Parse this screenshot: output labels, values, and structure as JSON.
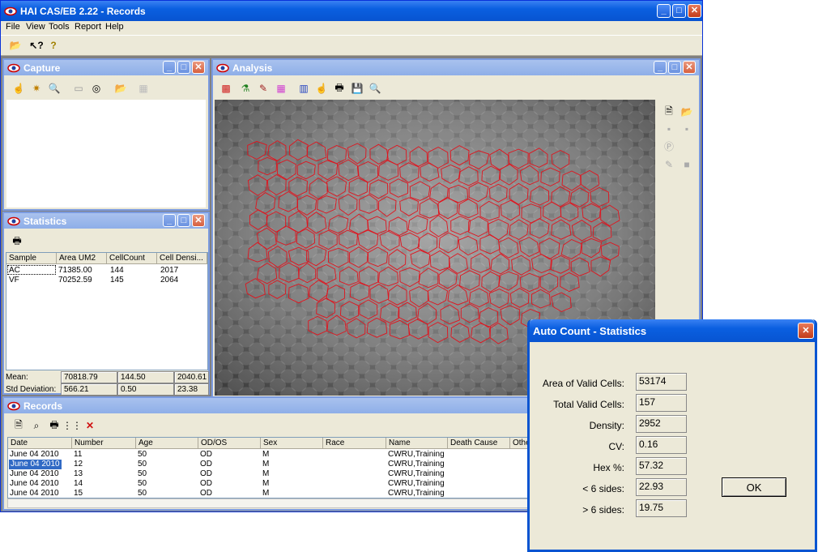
{
  "app": {
    "title": "HAI CAS/EB 2.22 - Records"
  },
  "menu": [
    "File",
    "View",
    "Tools",
    "Report",
    "Help"
  ],
  "capture": {
    "title": "Capture"
  },
  "analysis": {
    "title": "Analysis"
  },
  "statistics": {
    "title": "Statistics",
    "headers": [
      "Sample",
      "Area UM2",
      "CellCount",
      "Cell Densi..."
    ],
    "rows": [
      [
        "AC",
        "71385.00",
        "144",
        "2017"
      ],
      [
        "VF",
        "70252.59",
        "145",
        "2064"
      ]
    ],
    "mean_label": "Mean:",
    "mean": [
      "70818.79",
      "144.50",
      "2040.61"
    ],
    "std_label": "Std Deviation:",
    "std": [
      "566.21",
      "0.50",
      "23.38"
    ]
  },
  "records": {
    "title": "Records",
    "headers": [
      "Date",
      "Number",
      "Age",
      "OD/OS",
      "Sex",
      "Race",
      "Name",
      "Death Cause",
      "Othe"
    ],
    "rows": [
      [
        "June 04 2010",
        "11",
        "50",
        "OD",
        "M",
        "",
        "CWRU,Training"
      ],
      [
        "June 04 2010",
        "12",
        "50",
        "OD",
        "M",
        "",
        "CWRU,Training"
      ],
      [
        "June 04 2010",
        "13",
        "50",
        "OD",
        "M",
        "",
        "CWRU,Training"
      ],
      [
        "June 04 2010",
        "14",
        "50",
        "OD",
        "M",
        "",
        "CWRU,Training"
      ],
      [
        "June 04 2010",
        "15",
        "50",
        "OD",
        "M",
        "",
        "CWRU,Training"
      ]
    ],
    "selected_row": 1
  },
  "dialog": {
    "title": "Auto Count - Statistics",
    "fields": [
      {
        "label": "Area of Valid Cells:",
        "value": "53174"
      },
      {
        "label": "Total Valid Cells:",
        "value": "157"
      },
      {
        "label": "Density:",
        "value": "2952"
      },
      {
        "label": "CV:",
        "value": "0.16"
      },
      {
        "label": "Hex %:",
        "value": "57.32"
      },
      {
        "label": "< 6 sides:",
        "value": "22.93"
      },
      {
        "label": "> 6 sides:",
        "value": "19.75"
      }
    ],
    "ok": "OK"
  },
  "colors": {
    "xp_blue": "#0a5fe0",
    "cell_outline": "#e0141e",
    "selection": "#316ac5"
  }
}
